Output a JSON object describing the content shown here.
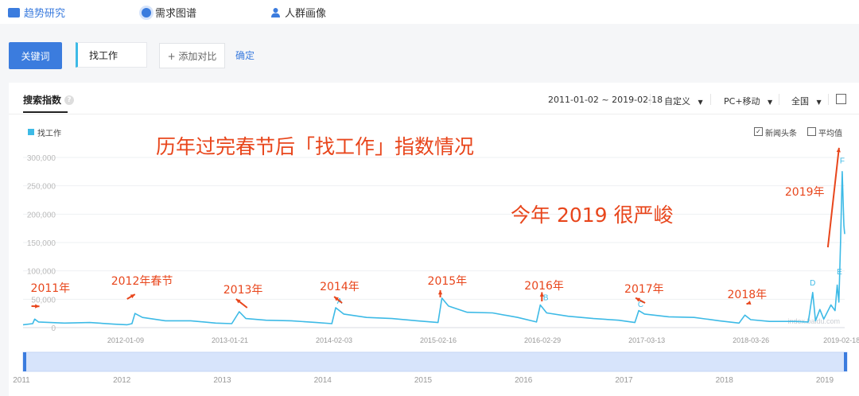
{
  "nav": {
    "trend": "趋势研究",
    "demand": "需求图谱",
    "crowd": "人群画像"
  },
  "search": {
    "keyword_button": "关键词",
    "keyword": "找工作",
    "add_compare": "+ 添加对比",
    "confirm": "确定"
  },
  "panel": {
    "title": "搜索指数",
    "date_range": "2011-01-02 ~ 2019-02-18",
    "custom": "自定义",
    "device": "PC+移动",
    "region": "全国",
    "legend": "找工作",
    "news_label": "新闻头条",
    "news_checked": true,
    "avg_label": "平均值",
    "avg_checked": false
  },
  "chart_data": {
    "type": "line",
    "title": "历年过完春节后「找工作」指数情况",
    "subtitle": "今年 2019 很严峻",
    "ylim": [
      0,
      300000
    ],
    "yticks": [
      "0",
      "50,000",
      "100,000",
      "150,000",
      "200,000",
      "250,000",
      "300,000"
    ],
    "xticks": [
      "2012-01-09",
      "2013-01-21",
      "2014-02-03",
      "2015-02-16",
      "2016-02-29",
      "2017-03-13",
      "2018-03-26",
      "2019-02-18"
    ],
    "overview_years": [
      "2011",
      "2012",
      "2013",
      "2014",
      "2015",
      "2016",
      "2017",
      "2018",
      "2019"
    ],
    "watermark": "index.baidu.com",
    "series": [
      {
        "name": "找工作",
        "color": "#3dbae6",
        "points": [
          [
            "2011-01-02",
            5000
          ],
          [
            "2011-02-06",
            7000
          ],
          [
            "2011-02-13",
            15000
          ],
          [
            "2011-02-27",
            10000
          ],
          [
            "2011-06-01",
            8000
          ],
          [
            "2011-09-01",
            9000
          ],
          [
            "2011-12-01",
            6000
          ],
          [
            "2012-01-15",
            5000
          ],
          [
            "2012-02-01",
            7000
          ],
          [
            "2012-02-12",
            25000
          ],
          [
            "2012-03-10",
            18000
          ],
          [
            "2012-06-01",
            12000
          ],
          [
            "2012-09-01",
            12000
          ],
          [
            "2012-12-01",
            8000
          ],
          [
            "2013-01-28",
            7000
          ],
          [
            "2013-02-24",
            28000
          ],
          [
            "2013-03-20",
            16000
          ],
          [
            "2013-06-01",
            13000
          ],
          [
            "2013-09-01",
            12000
          ],
          [
            "2013-12-01",
            9000
          ],
          [
            "2014-01-26",
            7000
          ],
          [
            "2014-02-09",
            35000
          ],
          [
            "2014-03-10",
            24000
          ],
          [
            "2014-06-01",
            18000
          ],
          [
            "2014-09-01",
            16000
          ],
          [
            "2014-12-01",
            12000
          ],
          [
            "2015-02-15",
            9000
          ],
          [
            "2015-03-01",
            52000
          ],
          [
            "2015-03-25",
            38000
          ],
          [
            "2015-06-01",
            27000
          ],
          [
            "2015-09-01",
            26000
          ],
          [
            "2015-12-01",
            18000
          ],
          [
            "2016-02-07",
            10000
          ],
          [
            "2016-02-21",
            40000
          ],
          [
            "2016-03-15",
            26000
          ],
          [
            "2016-06-01",
            20000
          ],
          [
            "2016-09-01",
            16000
          ],
          [
            "2016-12-01",
            13000
          ],
          [
            "2017-01-29",
            9000
          ],
          [
            "2017-02-12",
            30000
          ],
          [
            "2017-03-05",
            24000
          ],
          [
            "2017-06-01",
            19000
          ],
          [
            "2017-09-01",
            18000
          ],
          [
            "2017-12-01",
            12000
          ],
          [
            "2018-02-11",
            8000
          ],
          [
            "2018-03-04",
            22000
          ],
          [
            "2018-03-25",
            14000
          ],
          [
            "2018-06-01",
            11000
          ],
          [
            "2018-09-01",
            11000
          ],
          [
            "2018-10-20",
            10000
          ],
          [
            "2018-11-05",
            62000
          ],
          [
            "2018-11-15",
            12000
          ],
          [
            "2018-12-01",
            32000
          ],
          [
            "2018-12-15",
            15000
          ],
          [
            "2019-01-10",
            40000
          ],
          [
            "2019-01-25",
            30000
          ],
          [
            "2019-02-02",
            75000
          ],
          [
            "2019-02-08",
            45000
          ],
          [
            "2019-02-14",
            150000
          ],
          [
            "2019-02-20",
            275000
          ],
          [
            "2019-02-26",
            180000
          ],
          [
            "2019-03-01",
            165000
          ]
        ]
      }
    ],
    "news_markers": [
      {
        "label": "A",
        "date": "2014-02-23",
        "value": 38000
      },
      {
        "label": "B",
        "date": "2016-03-12",
        "value": 44000
      },
      {
        "label": "C",
        "date": "2017-02-19",
        "value": 32000
      },
      {
        "label": "D",
        "date": "2018-11-05",
        "value": 70000
      },
      {
        "label": "E",
        "date": "2019-02-10",
        "value": 90000
      },
      {
        "label": "F",
        "date": "2019-02-20",
        "value": 285000
      }
    ],
    "annotations": [
      {
        "text": "2011年",
        "date": "2011-02-13"
      },
      {
        "text": "2012年春节",
        "date": "2012-02-12"
      },
      {
        "text": "2013年",
        "date": "2013-02-24"
      },
      {
        "text": "2014年",
        "date": "2014-02-09"
      },
      {
        "text": "2015年",
        "date": "2015-03-01"
      },
      {
        "text": "2016年",
        "date": "2016-02-21"
      },
      {
        "text": "2017年",
        "date": "2017-02-12"
      },
      {
        "text": "2018年",
        "date": "2018-03-04"
      },
      {
        "text": "2019年",
        "date": "2019-02-20"
      }
    ],
    "annotation_color": "#e8461c"
  }
}
